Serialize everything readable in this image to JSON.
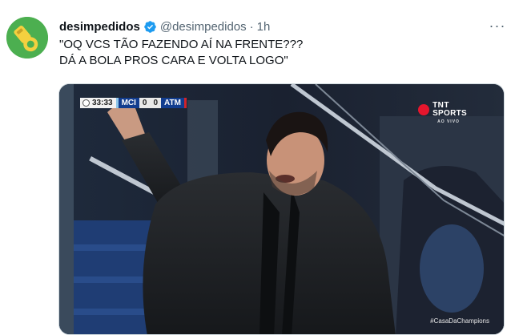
{
  "tweet": {
    "display_name": "desimpedidos",
    "handle": "@desimpedidos",
    "separator": "·",
    "time": "1h",
    "text_lines": [
      "\"OQ VCS TÃO FAZENDO AÍ NA FRENTE???",
      "DÁ A BOLA PROS CARA E VOLTA LOGO\""
    ],
    "more_label": "···"
  },
  "media": {
    "scorebug": {
      "clock": "33:33",
      "home": "MCI",
      "home_score": "0",
      "away_score": "0",
      "away": "ATM"
    },
    "broadcaster": {
      "line1": "TNT",
      "line2": "SPORTS",
      "line3": "AO VIVO"
    },
    "hashtag": "#CasaDaChampions"
  },
  "colors": {
    "accent_verified": "#1d9bf0",
    "avatar_bg": "#4caf50",
    "text_primary": "#0f1419",
    "text_secondary": "#536471"
  },
  "icons": {
    "avatar": "whistle-icon",
    "verified": "verified-badge-icon",
    "more": "more-options-icon"
  }
}
